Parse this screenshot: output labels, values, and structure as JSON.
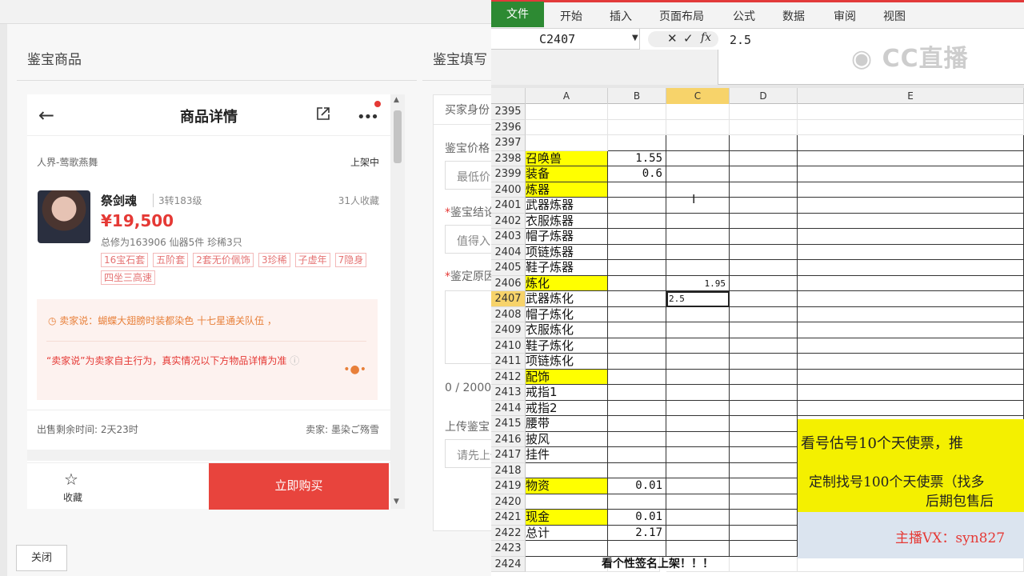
{
  "left": {
    "section_title_1": "鉴宝商品",
    "section_title_2": "鉴宝填写",
    "phone": {
      "title": "商品详情",
      "realm": "人界-莺歌燕舞",
      "status": "上架中",
      "char_name": "祭剑魂",
      "char_level": "3转183级",
      "favorites": "31人收藏",
      "price": "¥19,500",
      "stats": "总修为163906  仙器5件  珍稀3只",
      "tags": [
        "16宝石套",
        "五阶套",
        "2套无价佩饰",
        "3珍稀",
        "子虚年",
        "7隐身",
        "四坐三高速"
      ],
      "seller_says": "卖家说：蝴蝶大翅膀时装都染色 十七星通关队伍 ，",
      "disclaimer": "“卖家说”为卖家自主行为，真实情况以下方物品详情为准",
      "time_left": "出售剩余时间: 2天23时",
      "seller": "卖家: 墨染ご殇雪",
      "fav_label": "收藏",
      "buy_label": "立即购买"
    },
    "form": {
      "tab": "买家身份",
      "price_label": "鉴宝价格",
      "price_input": "最低价",
      "result_label": "鉴宝结论",
      "result_input": "值得入",
      "reason_label": "鉴定原因",
      "counter": "0 / 2000",
      "upload_label": "上传鉴宝",
      "upload_input": "请先上传"
    },
    "close_label": "关闭"
  },
  "excel": {
    "tabs": [
      "文件",
      "开始",
      "插入",
      "页面布局",
      "公式",
      "数据",
      "审阅",
      "视图"
    ],
    "name_box": "C2407",
    "formula": "2.5",
    "watermark": "CC直播",
    "columns": [
      "A",
      "B",
      "C",
      "D",
      "E"
    ],
    "selected_column": "C",
    "selected_row": "2407",
    "rows": [
      {
        "n": "2395",
        "a": "",
        "b": "",
        "c": "",
        "ya": false
      },
      {
        "n": "2396",
        "a": "",
        "b": "",
        "c": "",
        "ya": false
      },
      {
        "n": "2397",
        "a": "",
        "b": "",
        "c": "",
        "ya": false
      },
      {
        "n": "2398",
        "a": "召唤兽",
        "b": "1.55",
        "c": "",
        "ya": true
      },
      {
        "n": "2399",
        "a": "装备",
        "b": "0.6",
        "c": "",
        "ya": true
      },
      {
        "n": "2400",
        "a": "炼器",
        "b": "",
        "c": "",
        "ya": true
      },
      {
        "n": "2401",
        "a": "武器炼器",
        "b": "",
        "c": "",
        "ya": false
      },
      {
        "n": "2402",
        "a": "衣服炼器",
        "b": "",
        "c": "",
        "ya": false
      },
      {
        "n": "2403",
        "a": "帽子炼器",
        "b": "",
        "c": "",
        "ya": false
      },
      {
        "n": "2404",
        "a": "项链炼器",
        "b": "",
        "c": "",
        "ya": false
      },
      {
        "n": "2405",
        "a": "鞋子炼器",
        "b": "",
        "c": "",
        "ya": false
      },
      {
        "n": "2406",
        "a": "炼化",
        "b": "",
        "c": "1.95",
        "ya": true
      },
      {
        "n": "2407",
        "a": "武器炼化",
        "b": "",
        "c": "2.5",
        "ya": false
      },
      {
        "n": "2408",
        "a": "帽子炼化",
        "b": "",
        "c": "",
        "ya": false
      },
      {
        "n": "2409",
        "a": "衣服炼化",
        "b": "",
        "c": "",
        "ya": false
      },
      {
        "n": "2410",
        "a": "鞋子炼化",
        "b": "",
        "c": "",
        "ya": false
      },
      {
        "n": "2411",
        "a": "项链炼化",
        "b": "",
        "c": "",
        "ya": false
      },
      {
        "n": "2412",
        "a": "配饰",
        "b": "",
        "c": "",
        "ya": true
      },
      {
        "n": "2413",
        "a": "戒指1",
        "b": "",
        "c": "",
        "ya": false
      },
      {
        "n": "2414",
        "a": "戒指2",
        "b": "",
        "c": "",
        "ya": false
      },
      {
        "n": "2415",
        "a": "腰带",
        "b": "",
        "c": "",
        "ya": false
      },
      {
        "n": "2416",
        "a": "披风",
        "b": "",
        "c": "",
        "ya": false
      },
      {
        "n": "2417",
        "a": "挂件",
        "b": "",
        "c": "",
        "ya": false
      },
      {
        "n": "2418",
        "a": "",
        "b": "",
        "c": "",
        "ya": false
      },
      {
        "n": "2419",
        "a": "物资",
        "b": "0.01",
        "c": "",
        "ya": true
      },
      {
        "n": "2420",
        "a": "",
        "b": "",
        "c": "",
        "ya": false
      },
      {
        "n": "2421",
        "a": "现金",
        "b": "0.01",
        "c": "",
        "ya": true
      },
      {
        "n": "2422",
        "a": "总计",
        "b": "2.17",
        "c": "",
        "ya": false
      },
      {
        "n": "2423",
        "a": "",
        "b": "",
        "c": "",
        "ya": false
      },
      {
        "n": "2424",
        "a": "",
        "b": "看个性签名上架！！！",
        "c": "",
        "ya": false
      }
    ],
    "banner1": "看号估号10个天使票，推",
    "banner2_a": "定制找号100个天使票（找多",
    "banner2_b": "后期包售后",
    "banner3": "主播VX：syn827"
  }
}
